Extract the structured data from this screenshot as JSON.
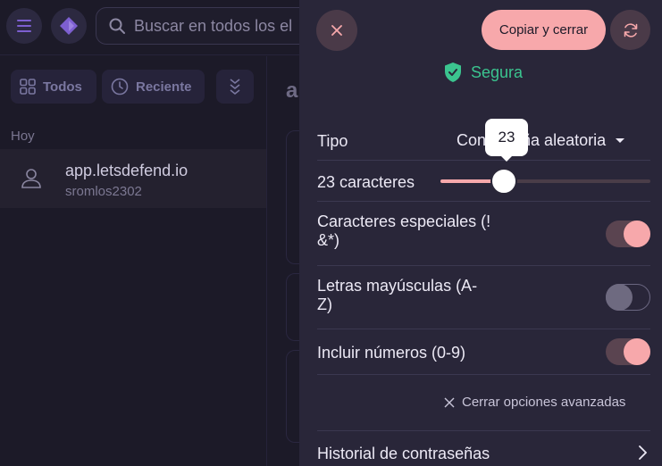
{
  "background": {
    "search": {
      "placeholder": "Buscar en todos los el"
    },
    "filters": {
      "all_label": "Todos",
      "recent_label": "Reciente"
    },
    "section_header": "Hoy",
    "item": {
      "title": "app.letsdefend.io",
      "subtitle": "sromlos2302"
    },
    "main_letter": "a"
  },
  "panel": {
    "copy_label": "Copiar y cerrar",
    "strength_label": "Segura",
    "type": {
      "label": "Tipo",
      "value": "Contraseña aleatoria"
    },
    "length": {
      "label": "23 caracteres",
      "value": 23,
      "fraction": 0.3,
      "tooltip": "23"
    },
    "options": {
      "special": {
        "label_line1": "Caracteres especiales (!",
        "label_line2": "&*)",
        "enabled": true
      },
      "uppercase": {
        "label_line1": "Letras mayúsculas (A-",
        "label_line2": "Z)",
        "enabled": false
      },
      "numbers": {
        "label": "Incluir números (0-9)",
        "enabled": true
      }
    },
    "close_advanced_label": "Cerrar opciones avanzadas",
    "history_label": "Historial de contraseñas"
  },
  "colors": {
    "accent": "#f7a8ab",
    "strength": "#3bc48f",
    "panel_bg": "#292639",
    "app_bg": "#1c1a28"
  }
}
